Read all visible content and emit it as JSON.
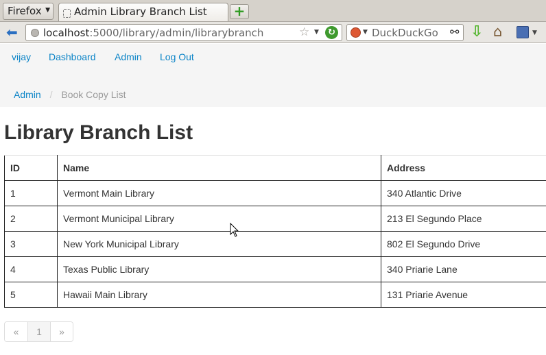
{
  "browser": {
    "menu_label": "Firefox",
    "tab_title": "Admin Library Branch List",
    "new_tab_label": "+",
    "url_host": "localhost",
    "url_rest": ":5000/library/admin/librarybranch",
    "search_placeholder": "DuckDuckGo",
    "icons": [
      "back-arrow-icon",
      "globe-icon",
      "star-icon",
      "reload-icon",
      "duckduckgo-icon",
      "binoculars-icon",
      "download-icon",
      "home-icon",
      "bookmarks-icon"
    ]
  },
  "nav": {
    "user": "vijay",
    "dashboard": "Dashboard",
    "admin": "Admin",
    "logout": "Log Out"
  },
  "breadcrumb": {
    "root": "Admin",
    "separator": "/",
    "current": "Book Copy List"
  },
  "page": {
    "title": "Library Branch List"
  },
  "table": {
    "headers": [
      "ID",
      "Name",
      "Address"
    ],
    "rows": [
      [
        "1",
        "Vermont Main Library",
        "340 Atlantic Drive"
      ],
      [
        "2",
        "Vermont Municipal Library",
        "213 El Segundo Place"
      ],
      [
        "3",
        "New York Municipal Library",
        "802 El Segundo Drive"
      ],
      [
        "4",
        "Texas Public Library",
        "340 Priarie Lane"
      ],
      [
        "5",
        "Hawaii Main Library",
        "131 Priarie Avenue"
      ]
    ]
  },
  "pagination": {
    "prev": "«",
    "current": "1",
    "next": "»"
  },
  "colors": {
    "link": "#0b84c7",
    "nav_background": "#f5f5f5",
    "text": "#333333"
  }
}
